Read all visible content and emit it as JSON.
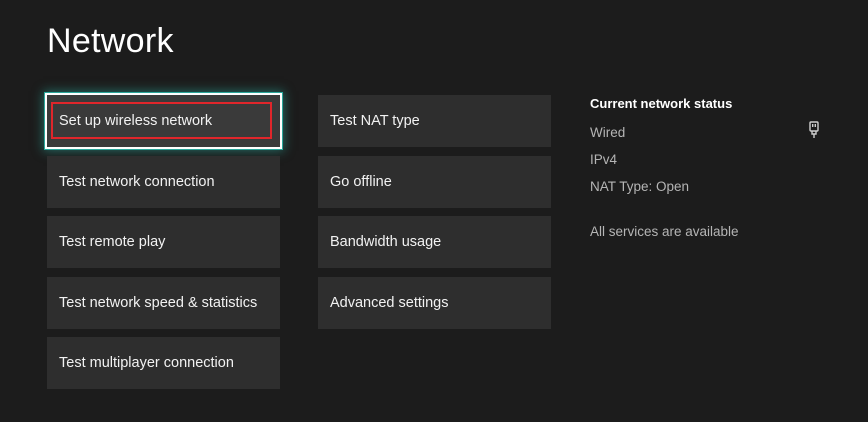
{
  "page": {
    "title": "Network"
  },
  "menu_left": [
    {
      "label": "Set up wireless network"
    },
    {
      "label": "Test network connection"
    },
    {
      "label": "Test remote play"
    },
    {
      "label": "Test network speed & statistics"
    },
    {
      "label": "Test multiplayer connection"
    }
  ],
  "menu_right": [
    {
      "label": "Test NAT type"
    },
    {
      "label": "Go offline"
    },
    {
      "label": "Bandwidth usage"
    },
    {
      "label": "Advanced settings"
    }
  ],
  "status": {
    "heading": "Current network status",
    "connection": "Wired",
    "connection_icon": "wired-plug-icon",
    "protocol": "IPv4",
    "nat": "NAT Type: Open",
    "services": "All services are available"
  },
  "colors": {
    "background": "#1c1c1c",
    "tile": "#2e2e2e",
    "focus_glow": "#2aa79b",
    "annotation_red": "#e0262b"
  }
}
